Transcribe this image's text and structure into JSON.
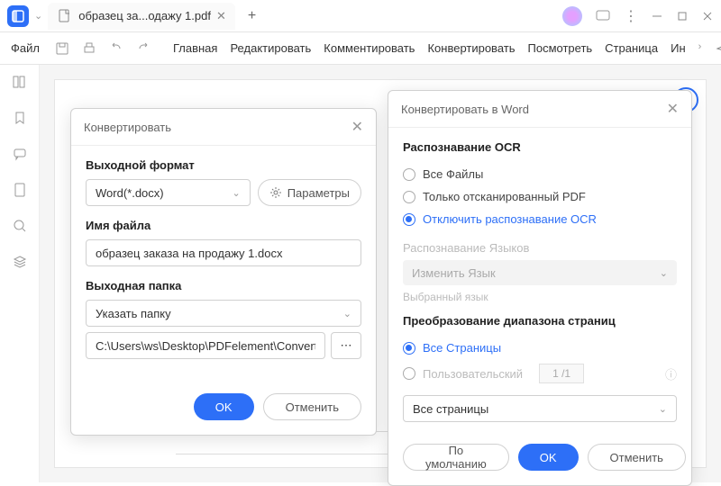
{
  "titlebar": {
    "tab_title": "образец за...одажу 1.pdf"
  },
  "menubar": {
    "file": "Файл",
    "tabs": [
      "Главная",
      "Редактировать",
      "Комментировать",
      "Конвертировать",
      "Посмотреть",
      "Страница",
      "Ин"
    ]
  },
  "convert_dialog": {
    "title": "Конвертировать",
    "format_label": "Выходной формат",
    "format_value": "Word(*.docx)",
    "params_btn": "Параметры",
    "filename_label": "Имя файла",
    "filename_value": "образец заказа на продажу 1.docx",
    "folder_label": "Выходная папка",
    "folder_select": "Указать папку",
    "folder_path": "C:\\Users\\ws\\Desktop\\PDFelement\\Convert",
    "ok": "OK",
    "cancel": "Отменить"
  },
  "word_dialog": {
    "title": "Конвертировать в Word",
    "ocr_section": "Распознавание OCR",
    "opt_all": "Все Файлы",
    "opt_scanned": "Только отсканированный PDF",
    "opt_disable": "Отключить распознавание OCR",
    "lang_section": "Распознавание Языков",
    "lang_change": "Изменить Язык",
    "lang_selected": "Выбранный язык",
    "range_section": "Преобразование диапазона страниц",
    "opt_allpages": "Все Страницы",
    "opt_custom": "Пользовательский",
    "page_indicator": "1 /1",
    "pages_select": "Все страницы",
    "default_btn": "По умолчанию",
    "ok": "OK",
    "cancel": "Отменить"
  }
}
